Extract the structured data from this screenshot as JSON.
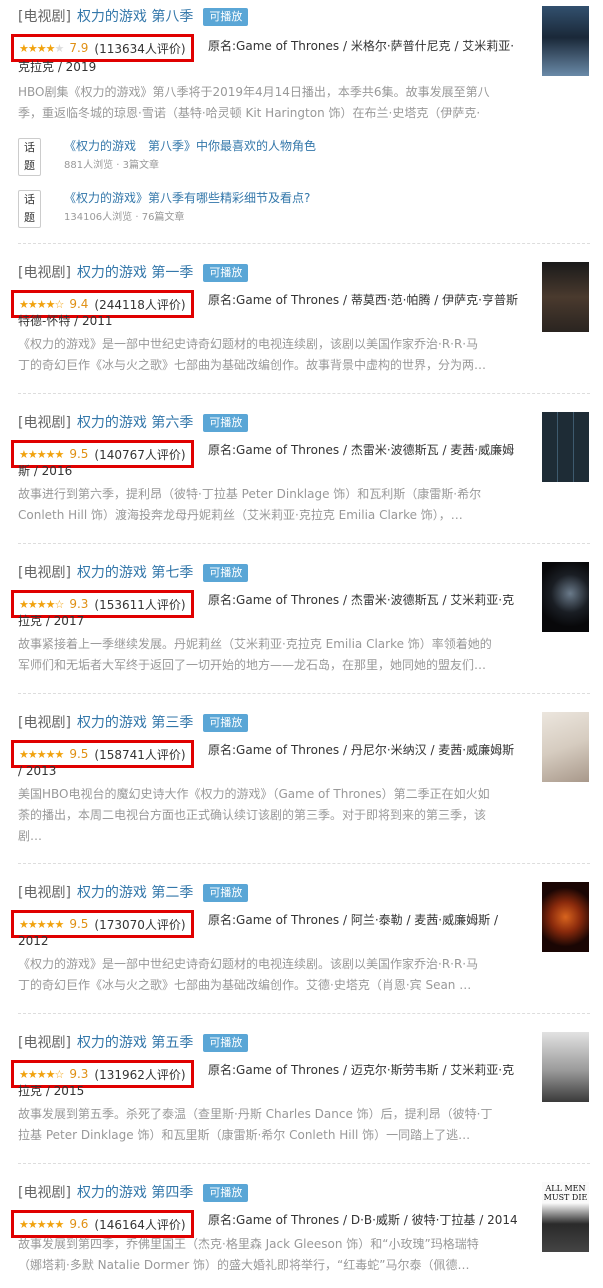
{
  "entries": [
    {
      "category": "[电视剧]",
      "title": "权力的游戏 第八季",
      "playable": "可播放",
      "stars": [
        "full",
        "full",
        "full",
        "full",
        "empty"
      ],
      "score": "7.9",
      "votes": "(113634人评价)",
      "meta": "原名:Game of Thrones / 米格尔·萨普什尼克 / 艾米莉亚·克拉克 / 2019",
      "meta_line1": "原名:Game of Thrones / 米格尔·萨普什尼克 / 艾米莉亚·",
      "meta_line2": "克拉克 / 2019",
      "desc_line1": "HBO剧集《权力的游戏》第八季将于2019年4月14日播出，本季共6集。故事发展至第八",
      "desc_line2": "季，重返临冬城的琼恩·雪诺（基特·哈灵顿 Kit Harington 饰）在布兰·史塔克（伊萨克·",
      "poster_colors": [
        "#1a2a3a",
        "#5a7a98"
      ]
    },
    {
      "category": "[电视剧]",
      "title": "权力的游戏 第一季",
      "playable": "可播放",
      "stars": [
        "full",
        "full",
        "full",
        "full",
        "half"
      ],
      "score": "9.4",
      "votes": "(244118人评价)",
      "meta_line1": "原名:Game of Thrones / 蒂莫西·范·帕腾 / 伊萨克·亨普斯",
      "meta_line2": "特德-怀特 / 2011",
      "desc_line1": "《权力的游戏》是一部中世纪史诗奇幻题材的电视连续剧，该剧以美国作家乔治·R·R·马",
      "desc_line2": "丁的奇幻巨作《冰与火之歌》七部曲为基础改编创作。故事背景中虚构的世界，分为两…",
      "poster_colors": [
        "#2a2a2a",
        "#6a5a4a"
      ]
    },
    {
      "category": "[电视剧]",
      "title": "权力的游戏 第六季",
      "playable": "可播放",
      "stars": [
        "full",
        "full",
        "full",
        "full",
        "full"
      ],
      "score": "9.5",
      "votes": "(140767人评价)",
      "meta_line1": "原名:Game of Thrones / 杰雷米·波德斯瓦 / 麦茜·威廉姆",
      "meta_line2": "斯 / 2016",
      "desc_line1": "故事进行到第六季，提利昂（彼特·丁拉基 Peter Dinklage 饰）和瓦利斯（康雷斯·希尔",
      "desc_line2": "Conleth Hill 饰）渡海投奔龙母丹妮莉丝（艾米莉亚·克拉克 Emilia Clarke 饰），…",
      "poster_colors": [
        "#1e2c36",
        "#4a6a80"
      ]
    },
    {
      "category": "[电视剧]",
      "title": "权力的游戏 第七季",
      "playable": "可播放",
      "stars": [
        "full",
        "full",
        "full",
        "full",
        "half"
      ],
      "score": "9.3",
      "votes": "(153611人评价)",
      "meta_line1": "原名:Game of Thrones / 杰雷米·波德斯瓦 / 艾米莉亚·克",
      "meta_line2": "拉克 / 2017",
      "desc_line1": "故事紧接着上一季继续发展。丹妮莉丝（艾米莉亚·克拉克 Emilia Clarke 饰）率领着她的",
      "desc_line2": "军师们和无垢者大军终于返回了一切开始的地方——龙石岛，在那里，她同她的盟友们…",
      "poster_colors": [
        "#0e0e12",
        "#3a4a5a"
      ]
    },
    {
      "category": "[电视剧]",
      "title": "权力的游戏 第三季",
      "playable": "可播放",
      "stars": [
        "full",
        "full",
        "full",
        "full",
        "full"
      ],
      "score": "9.5",
      "votes": "(158741人评价)",
      "meta_line1": "原名:Game of Thrones / 丹尼尔·米纳汉 / 麦茜·威廉姆斯",
      "meta_line2": "/ 2013",
      "desc_line1": "美国HBO电视台的魔幻史诗大作《权力的游戏》（Game of Thrones）第二季正在如火如",
      "desc_line2": "荼的播出，本周二电视台方面也正式确认续订该剧的第三季。对于即将到来的第三季，该",
      "desc_line3": "剧…",
      "poster_colors": [
        "#e8e0d6",
        "#b8a898"
      ]
    },
    {
      "category": "[电视剧]",
      "title": "权力的游戏 第二季",
      "playable": "可播放",
      "stars": [
        "full",
        "full",
        "full",
        "full",
        "full"
      ],
      "score": "9.5",
      "votes": "(173070人评价)",
      "meta_line1": "原名:Game of Thrones / 阿兰·泰勒 / 麦茜·威廉姆斯 /",
      "meta_line2": "2012",
      "desc_line1": "《权力的游戏》是一部中世纪史诗奇幻题材的电视连续剧。该剧以美国作家乔治·R·R·马",
      "desc_line2": "丁的奇幻巨作《冰与火之歌》七部曲为基础改编创作。艾德·史塔克（肖恩·宾 Sean …",
      "poster_colors": [
        "#2a0a06",
        "#c04a18"
      ]
    },
    {
      "category": "[电视剧]",
      "title": "权力的游戏 第五季",
      "playable": "可播放",
      "stars": [
        "full",
        "full",
        "full",
        "full",
        "half"
      ],
      "score": "9.3",
      "votes": "(131962人评价)",
      "meta_line1": "原名:Game of Thrones / 迈克尔·斯劳韦斯 / 艾米莉亚·克",
      "meta_line2": "拉克 / 2015",
      "desc_line1": "故事发展到第五季。杀死了泰温（查里斯·丹斯 Charles Dance 饰）后，提利昂（彼特·丁",
      "desc_line2": "拉基 Peter Dinklage 饰）和瓦里斯（康雷斯·希尔 Conleth Hill 饰）一同踏上了逃…",
      "poster_colors": [
        "#d0d0d0",
        "#5a5a5a"
      ]
    },
    {
      "category": "[电视剧]",
      "title": "权力的游戏 第四季",
      "playable": "可播放",
      "stars": [
        "full",
        "full",
        "full",
        "full",
        "full"
      ],
      "score": "9.6",
      "votes": "(146164人评价)",
      "meta_line1": "原名:Game of Thrones / D·B·威斯 / 彼特·丁拉基 / 2014",
      "desc_line1": "故事发展到第四季，乔佛里国王（杰克·格里森 Jack Gleeson 饰）和“小玫瑰”玛格瑞特",
      "desc_line2": "（娜塔莉·多默 Natalie Dormer 饰）的盛大婚礼即将举行，“红毒蛇”马尔泰（佩德…",
      "poster_text": "ALL MEN MUST DIE",
      "poster_colors": [
        "#f4f4f4",
        "#2a2a2a"
      ]
    }
  ],
  "topics": [
    {
      "tag": "话题",
      "title": "《权力的游戏　第八季》中你最喜欢的人物角色",
      "meta": "881人浏览 · 3篇文章"
    },
    {
      "tag": "话题",
      "title": "《权力的游戏》第八季有哪些精彩细节及看点?",
      "meta": "134106人浏览 · 76篇文章"
    }
  ]
}
